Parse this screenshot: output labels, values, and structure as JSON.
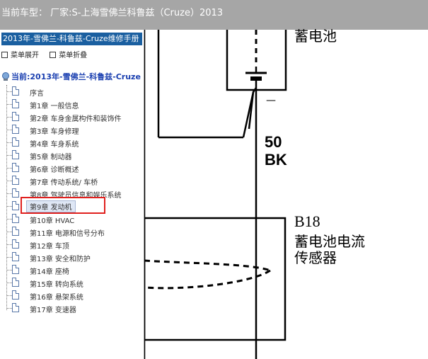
{
  "window": {
    "title": "当前车型： 厂家:S-上海雪佛兰科鲁兹（Cruze）2013"
  },
  "sidebar": {
    "manual_title": "2013年-雪佛兰-科鲁兹-Cruze维修手册",
    "expand_label": "菜单展开",
    "collapse_label": "菜单折叠",
    "root_label": "当前:2013年-雪佛兰-科鲁兹-Cruze",
    "items": [
      {
        "label": "序言"
      },
      {
        "label": "第1章 一般信息"
      },
      {
        "label": "第2章 车身金属构件和装饰件"
      },
      {
        "label": "第3章 车身修理"
      },
      {
        "label": "第4章 车身系统"
      },
      {
        "label": "第5章 制动器"
      },
      {
        "label": "第6章 诊断概述"
      },
      {
        "label": "第7章 传动系统/ 车桥"
      },
      {
        "label": "第8章 驾驶员信息和娱乐系统"
      },
      {
        "label": "第9章 发动机"
      },
      {
        "label": "第10章 HVAC"
      },
      {
        "label": "第11章 电源和信号分布"
      },
      {
        "label": "第12章 车顶"
      },
      {
        "label": "第13章 安全和防护"
      },
      {
        "label": "第14章 座椅"
      },
      {
        "label": "第15章 转向系统"
      },
      {
        "label": "第16章 悬架系统"
      },
      {
        "label": "第17章 变速器"
      }
    ],
    "selected_index": 9
  },
  "diagram": {
    "battery_label": "蓄电池",
    "terminal_label": "—",
    "wire_number": "50",
    "wire_color": "BK",
    "component_ref": "B18",
    "component_name_line1": "蓄电池电流",
    "component_name_line2": "传感器"
  }
}
